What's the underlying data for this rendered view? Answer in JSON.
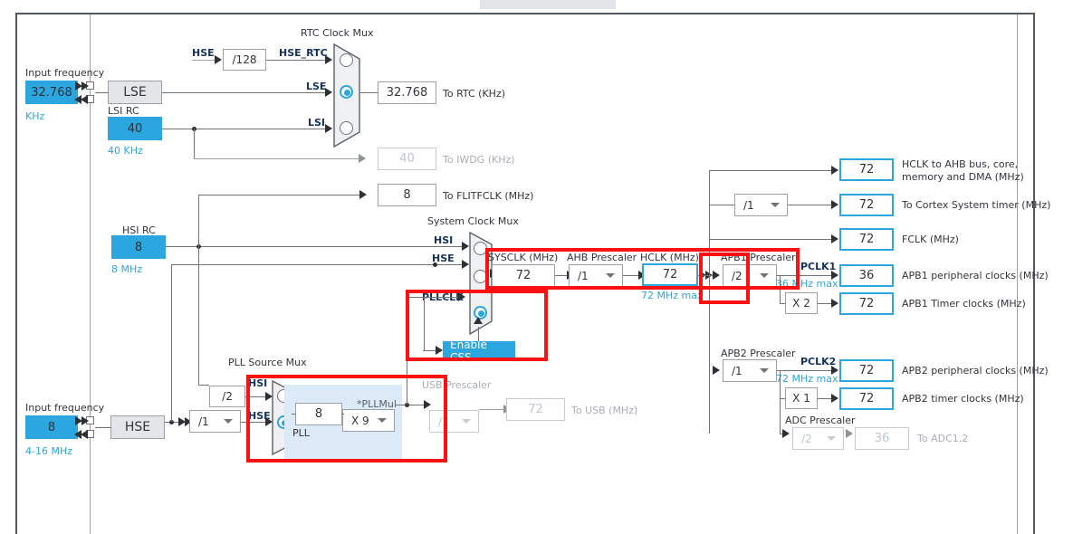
{
  "canvas": {
    "bg": "#ffffff",
    "accent": "#2ca6df",
    "annotation": "#fb1111"
  },
  "lse": {
    "input_frequency_label": "Input frequency",
    "value": "32.768",
    "unit": "KHz",
    "osc_label": "LSE"
  },
  "lsi": {
    "title": "LSI RC",
    "value": "40",
    "unit": "40 KHz"
  },
  "hse": {
    "input_frequency_label": "Input frequency",
    "value": "8",
    "unit": "4-16 MHz",
    "osc_label": "HSE"
  },
  "hsi": {
    "title": "HSI RC",
    "value": "8",
    "unit": "8 MHz"
  },
  "rtc_mux": {
    "title": "RTC Clock Mux",
    "inputs": [
      {
        "label": "HSE_RTC",
        "selected": false
      },
      {
        "label": "LSE",
        "selected": true
      },
      {
        "label": "LSI",
        "selected": false
      }
    ],
    "prescaler": "/128"
  },
  "hse_div_label": "HSE",
  "outputs_left": [
    {
      "name": "to-rtc",
      "value": "32.768",
      "label": "To RTC (KHz)",
      "dim": false
    },
    {
      "name": "to-iwdg",
      "value": "40",
      "label": "To IWDG (KHz)",
      "dim": true
    },
    {
      "name": "to-flitfclk",
      "value": "8",
      "label": "To FLITFCLK (MHz)",
      "dim": false
    }
  ],
  "sysclk_mux": {
    "title": "System Clock Mux",
    "inputs": [
      {
        "label": "HSI",
        "selected": false
      },
      {
        "label": "HSE",
        "selected": false
      },
      {
        "label": "PLLCLK",
        "selected": true
      }
    ],
    "css_button": "Enable CSS"
  },
  "sysclk": {
    "label": "SYSCLK (MHz)",
    "value": "72"
  },
  "ahb_prescaler": {
    "label": "AHB Prescaler",
    "value": "/1"
  },
  "hclk": {
    "label": "HCLK (MHz)",
    "value": "72",
    "max": "72 MHz max"
  },
  "pll_source_mux": {
    "title": "PLL Source Mux",
    "inputs": [
      {
        "label": "HSI",
        "selected": false,
        "prescaler": "/2"
      },
      {
        "label": "HSE",
        "selected": true,
        "prescaler": "/1"
      }
    ]
  },
  "pll": {
    "group_label": "PLL",
    "input_value": "8",
    "mul_label": "*PLLMul",
    "mul_value": "X 9"
  },
  "usb": {
    "prescaler_label": "USB Prescaler",
    "prescaler_value": "/1",
    "value": "72",
    "label": "To USB (MHz)"
  },
  "ahb_outputs": [
    {
      "name": "hclk-ahb",
      "value": "72",
      "label": "HCLK to AHB bus, core, memory and DMA (MHz)",
      "two_line": true
    },
    {
      "name": "cortex-timer",
      "value": "72",
      "label": "To Cortex System timer (MHz)",
      "prescaler": "/1"
    },
    {
      "name": "fclk",
      "value": "72",
      "label": "FCLK (MHz)"
    }
  ],
  "apb1": {
    "prescaler_label": "APB1 Prescaler",
    "prescaler_value": "/2",
    "pclk_label": "PCLK1",
    "max": "36 MHz max",
    "peripheral": {
      "value": "36",
      "label": "APB1 peripheral clocks (MHz)"
    },
    "timer_mul": "X 2",
    "timer": {
      "value": "72",
      "label": "APB1 Timer clocks (MHz)"
    }
  },
  "apb2": {
    "prescaler_label": "APB2 Prescaler",
    "prescaler_value": "/1",
    "pclk_label": "PCLK2",
    "max": "72 MHz max",
    "peripheral": {
      "value": "72",
      "label": "APB2 peripheral clocks (MHz)"
    },
    "timer_mul": "X 1",
    "timer": {
      "value": "72",
      "label": "APB2 timer clocks (MHz)"
    },
    "adc_prescaler_label": "ADC Prescaler",
    "adc_prescaler_value": "/2",
    "adc": {
      "value": "36",
      "label": "To ADC1,2"
    }
  }
}
